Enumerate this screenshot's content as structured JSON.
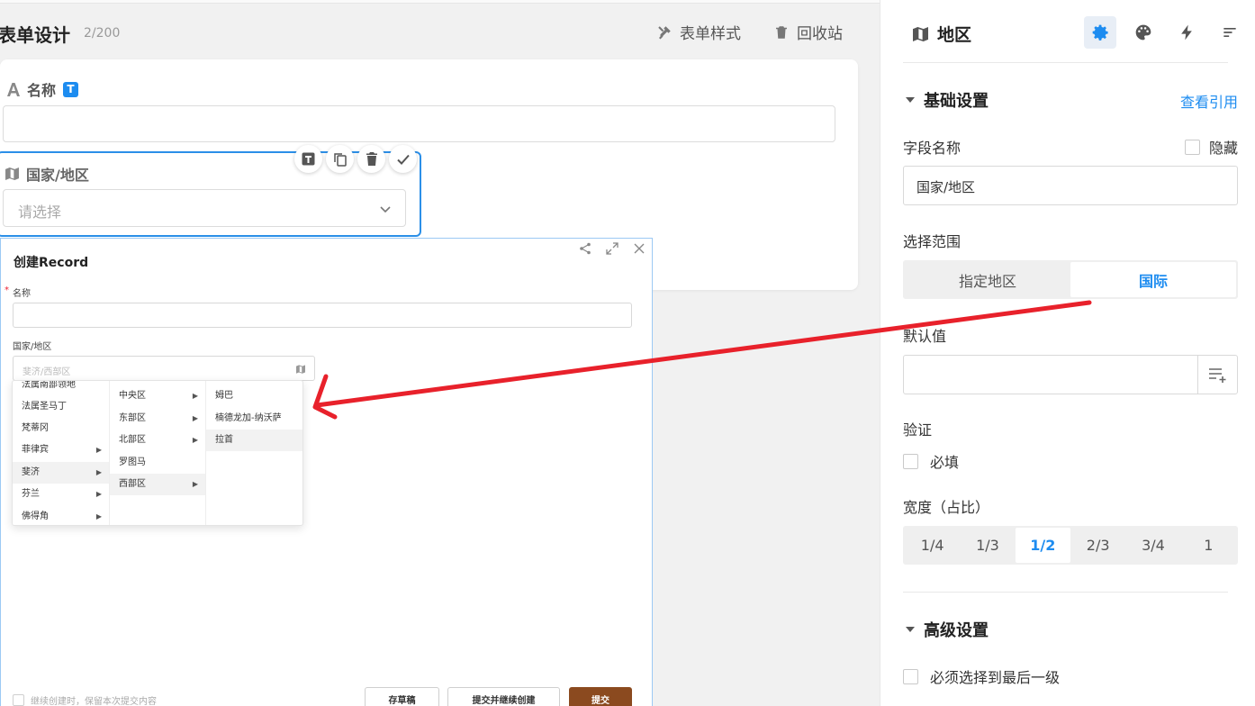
{
  "header": {
    "title": "表单设计",
    "count": "2/200",
    "style_btn": "表单样式",
    "recycle_btn": "回收站"
  },
  "canvas": {
    "name_field_label": "名称",
    "name_field_badge": "T",
    "region_field_label": "国家/地区",
    "region_placeholder": "请选择"
  },
  "dialog": {
    "title": "创建Record",
    "name_label": "名称",
    "region_label": "国家/地区",
    "region_value": "斐济/西部区",
    "cascader": {
      "col1": [
        "法属南部领地",
        "法属圣马丁",
        "梵蒂冈",
        "菲律宾",
        "斐济",
        "芬兰",
        "佛得角"
      ],
      "col2": [
        "中央区",
        "东部区",
        "北部区",
        "罗图马",
        "西部区"
      ],
      "col3": [
        "姆巴",
        "楠德龙加-纳沃萨",
        "拉首"
      ]
    },
    "continue_label": "继续创建时，保留本次提交内容",
    "draft_btn": "存草稿",
    "submit_continue_btn": "提交并继续创建",
    "submit_btn": "提交"
  },
  "panel": {
    "title": "地区",
    "section_basic": "基础设置",
    "view_refs": "查看引用",
    "field_name_label": "字段名称",
    "hide_label": "隐藏",
    "field_name_value": "国家/地区",
    "range_label": "选择范围",
    "range_options": [
      "指定地区",
      "国际"
    ],
    "range_selected": "国际",
    "default_label": "默认值",
    "validation_label": "验证",
    "required_label": "必填",
    "width_label": "宽度（占比）",
    "width_options": [
      "1/4",
      "1/3",
      "1/2",
      "2/3",
      "3/4",
      "1"
    ],
    "width_selected": "1/2",
    "section_advanced": "高级设置",
    "last_level_label": "必须选择到最后一级"
  },
  "colors": {
    "accent": "#1d8cf0",
    "submit": "#8b4a1f",
    "annotation_arrow": "#e8212b"
  }
}
